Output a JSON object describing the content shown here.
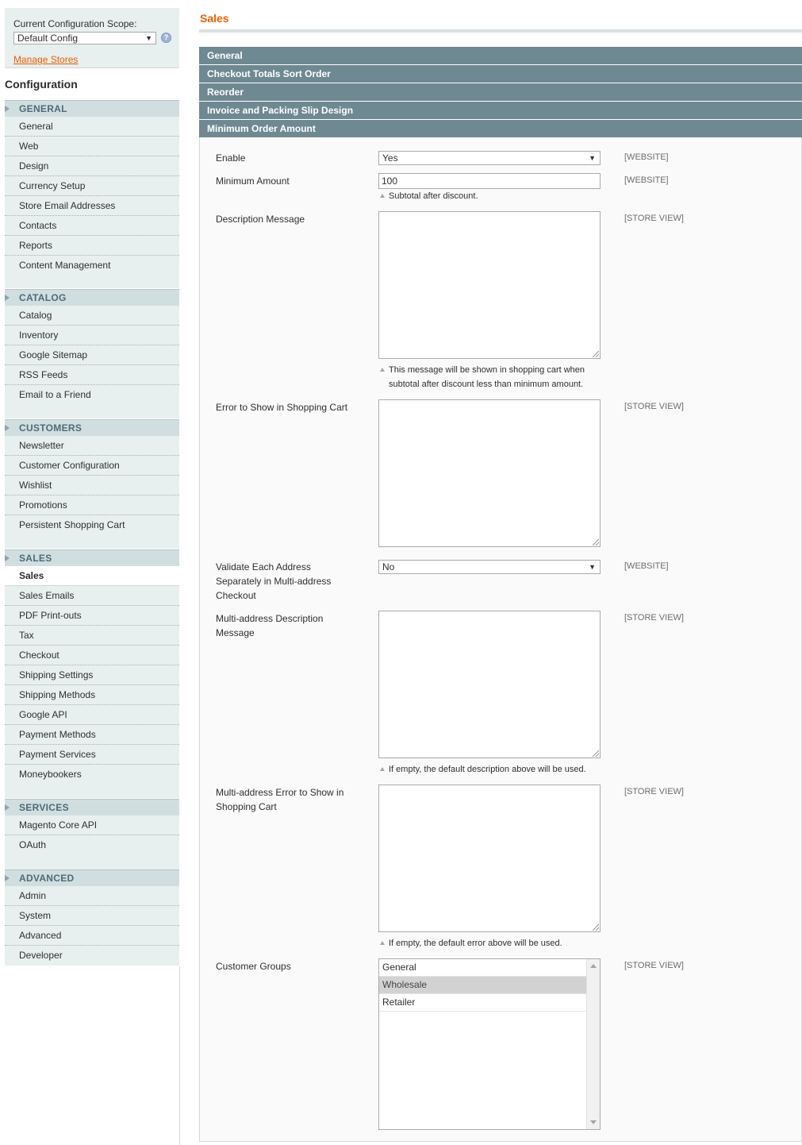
{
  "scope": {
    "label": "Current Configuration Scope:",
    "value": "Default Config",
    "help_icon": "help-icon",
    "manage_stores": "Manage Stores"
  },
  "sidebar": {
    "title": "Configuration",
    "sections": [
      {
        "title": "GENERAL",
        "items": [
          "General",
          "Web",
          "Design",
          "Currency Setup",
          "Store Email Addresses",
          "Contacts",
          "Reports",
          "Content Management"
        ]
      },
      {
        "title": "CATALOG",
        "items": [
          "Catalog",
          "Inventory",
          "Google Sitemap",
          "RSS Feeds",
          "Email to a Friend"
        ]
      },
      {
        "title": "CUSTOMERS",
        "items": [
          "Newsletter",
          "Customer Configuration",
          "Wishlist",
          "Promotions",
          "Persistent Shopping Cart"
        ]
      },
      {
        "title": "SALES",
        "items": [
          "Sales",
          "Sales Emails",
          "PDF Print-outs",
          "Tax",
          "Checkout",
          "Shipping Settings",
          "Shipping Methods",
          "Google API",
          "Payment Methods",
          "Payment Services",
          "Moneybookers"
        ],
        "active": "Sales"
      },
      {
        "title": "SERVICES",
        "items": [
          "Magento Core API",
          "OAuth"
        ]
      },
      {
        "title": "ADVANCED",
        "items": [
          "Admin",
          "System",
          "Advanced",
          "Developer"
        ]
      }
    ]
  },
  "main": {
    "title": "Sales",
    "groups": [
      "General",
      "Checkout Totals Sort Order",
      "Reorder",
      "Invoice and Packing Slip Design",
      "Minimum Order Amount"
    ],
    "fields": {
      "enable": {
        "label": "Enable",
        "value": "Yes",
        "scope": "[WEBSITE]"
      },
      "minimum_amount": {
        "label": "Minimum Amount",
        "value": "100",
        "note": "Subtotal after discount.",
        "scope": "[WEBSITE]"
      },
      "description_message": {
        "label": "Description Message",
        "note_line1": "This message will be shown in shopping cart when",
        "note_line2": "subtotal after discount less than minimum amount.",
        "scope": "[STORE VIEW]"
      },
      "error_message": {
        "label": "Error to Show in Shopping Cart",
        "scope": "[STORE VIEW]"
      },
      "validate_each": {
        "label_line1": "Validate Each Address",
        "label_line2": "Separately in Multi-address",
        "label_line3": "Checkout",
        "value": "No",
        "scope": "[WEBSITE]"
      },
      "multi_description": {
        "label_line1": "Multi-address Description",
        "label_line2": "Message",
        "note": "If empty, the default description above will be used.",
        "scope": "[STORE VIEW]"
      },
      "multi_error": {
        "label_line1": "Multi-address Error to Show in",
        "label_line2": "Shopping Cart",
        "note": "If empty, the default error above will be used.",
        "scope": "[STORE VIEW]"
      },
      "customer_groups": {
        "label": "Customer Groups",
        "options": [
          "General",
          "Wholesale",
          "Retailer"
        ],
        "selected": "Wholesale",
        "scope": "[STORE VIEW]"
      }
    }
  },
  "colors": {
    "accent": "#eb5e00",
    "group_header": "#6f8992",
    "sidebar_bg": "#e7efef",
    "section_head": "#d1dedf"
  }
}
